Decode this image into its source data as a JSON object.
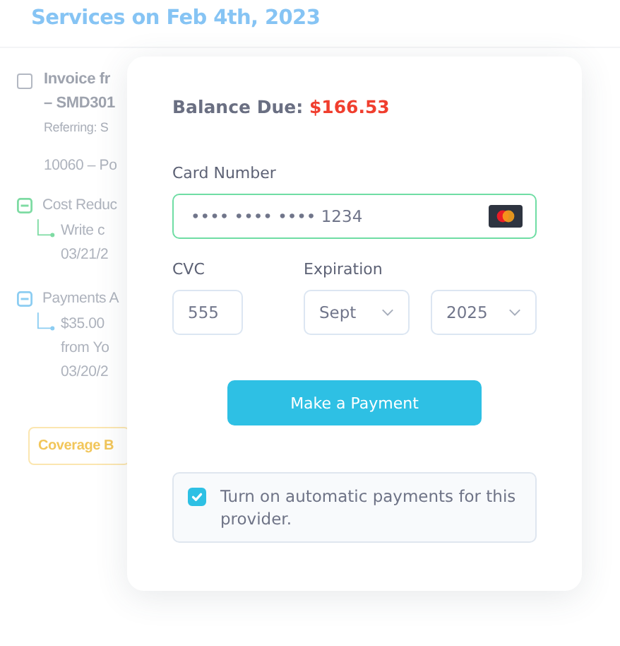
{
  "background": {
    "heading": "Services on Feb 4th, 2023",
    "invoice": {
      "checked": false,
      "title": "Invoice fr",
      "subtitle": "– SMD301",
      "referring": "Referring: S",
      "code": "10060 – Po"
    },
    "sections": [
      {
        "label": "Cost Reduc",
        "expanded": true,
        "color": "#7edba3",
        "entries": [
          [
            "Write c",
            "03/21/2"
          ]
        ]
      },
      {
        "label": "Payments A",
        "expanded": true,
        "color": "#8ccdf2",
        "entries": [
          [
            "$35.00",
            "from Yo",
            "03/20/2"
          ]
        ]
      }
    ],
    "coverage_button": "Coverage B"
  },
  "payment": {
    "balance_label": "Balance Due:",
    "balance": "$166.53",
    "card_label": "Card Number",
    "card_value": "•••• •••• •••• 1234",
    "cvc_label": "CVC",
    "cvc_value": "555",
    "expiration_label": "Expiration",
    "month": "Sept",
    "year": "2025",
    "submit": "Make a Payment",
    "autopay": {
      "checked": true,
      "label": "Turn on automatic payments for this provider."
    }
  }
}
